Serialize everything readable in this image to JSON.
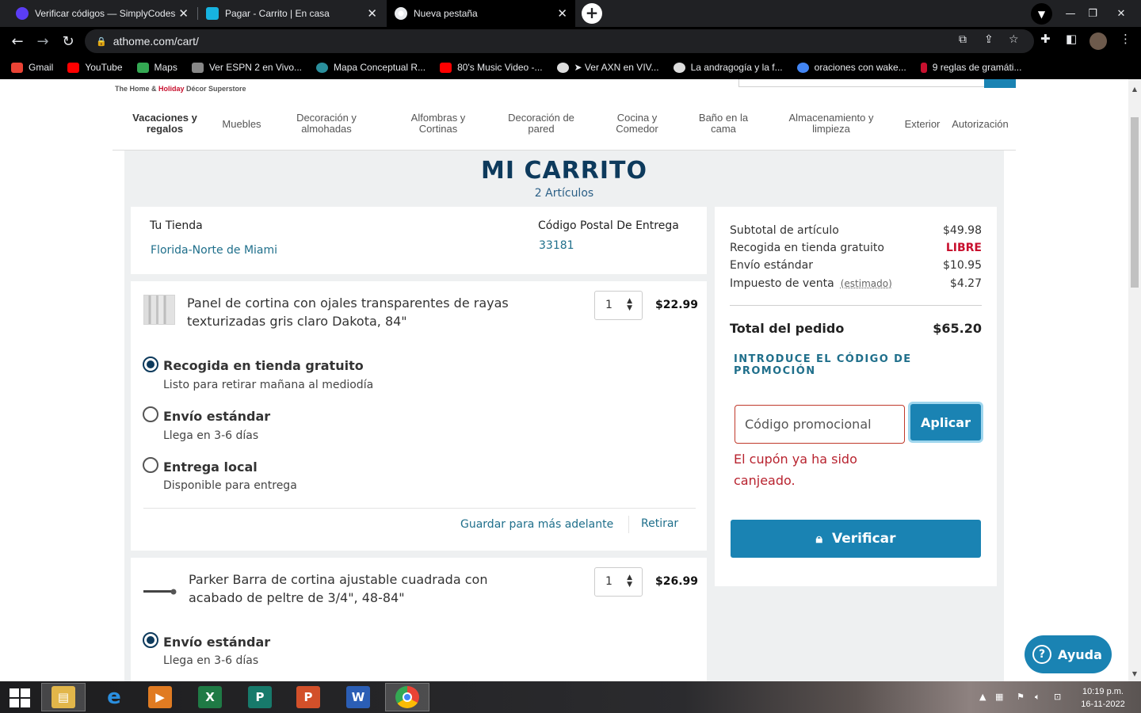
{
  "browser": {
    "tabs": [
      {
        "title": "Verificar códigos — SimplyCodes",
        "icon": "simplycodes-icon"
      },
      {
        "title": "Pagar - Carrito | En casa",
        "icon": "athome-icon"
      },
      {
        "title": "Nueva pestaña",
        "icon": "chrome-icon"
      }
    ],
    "url": "athome.com/cart/",
    "bookmarks": [
      {
        "label": "Gmail",
        "color": "#ea4335"
      },
      {
        "label": "YouTube",
        "color": "#ff0000"
      },
      {
        "label": "Maps",
        "color": "#34a853"
      },
      {
        "label": "Ver ESPN 2 en Vivo...",
        "color": "#888888"
      },
      {
        "label": "Mapa Conceptual R...",
        "color": "#2a8f9c"
      },
      {
        "label": "80's Music Video -...",
        "color": "#ff0000"
      },
      {
        "label": "➤ Ver AXN en VIV...",
        "color": "#dddddd"
      },
      {
        "label": "La andragogía y la f...",
        "color": "#dddddd"
      },
      {
        "label": "oraciones con wake...",
        "color": "#4285f4"
      },
      {
        "label": "9 reglas de gramáti...",
        "color": "#c8102e"
      }
    ]
  },
  "site": {
    "tagline_prefix": "The Home & ",
    "tagline_holiday": "Holiday",
    "tagline_suffix": " Décor Superstore",
    "nav": [
      "Vacaciones y regalos",
      "Muebles",
      "Decoración y almohadas",
      "Alfombras y Cortinas",
      "Decoración de pared",
      "Cocina y Comedor",
      "Baño en la cama",
      "Almacenamiento y limpieza",
      "Exterior",
      "Autorización"
    ]
  },
  "cart": {
    "title": "MI CARRITO",
    "count": "2 Artículos",
    "store_label": "Tu Tienda",
    "store_value": "Florida-Norte de Miami",
    "zip_label": "Código Postal De Entrega",
    "zip_value": "33181",
    "items": [
      {
        "name": "Panel de cortina con ojales transparentes de rayas texturizadas gris claro Dakota, 84\"",
        "qty": "1",
        "price": "$22.99",
        "options": [
          {
            "title": "Recogida en tienda gratuito",
            "sub": "Listo para retirar mañana al mediodía",
            "selected": true
          },
          {
            "title": "Envío estándar",
            "sub": "Llega en 3-6 días",
            "selected": false
          },
          {
            "title": "Entrega local",
            "sub": "Disponible para entrega",
            "selected": false
          }
        ],
        "save_later": "Guardar para más adelante",
        "remove": "Retirar"
      },
      {
        "name": "Parker Barra de cortina ajustable cuadrada con acabado de peltre de 3/4\", 48-84\"",
        "qty": "1",
        "price": "$26.99",
        "options": [
          {
            "title": "Envío estándar",
            "sub": "Llega en 3-6 días",
            "selected": true
          }
        ]
      }
    ]
  },
  "summary": {
    "subtotal_label": "Subtotal de artículo",
    "subtotal_value": "$49.98",
    "pickup_label": "Recogida en tienda gratuito",
    "pickup_value": "LIBRE",
    "shipping_label": "Envío estándar",
    "shipping_value": "$10.95",
    "tax_label": "Impuesto de venta",
    "tax_note": "(estimado)",
    "tax_value": "$4.27",
    "total_label": "Total del pedido",
    "total_value": "$65.20",
    "promo_link": "INTRODUCE EL CÓDIGO DE PROMOCIÓN",
    "promo_placeholder": "Código promocional",
    "apply_label": "Aplicar",
    "promo_error": "El cupón ya ha sido canjeado.",
    "checkout_label": "Verificar"
  },
  "help_label": "Ayuda",
  "taskbar": {
    "time": "10:19 p.m.",
    "date": "16-11-2022",
    "apps": [
      "file-explorer-icon",
      "internet-explorer-icon",
      "media-player-icon",
      "excel-icon",
      "publisher-icon",
      "powerpoint-icon",
      "word-icon",
      "chrome-icon"
    ]
  },
  "colors": {
    "accent": "#1a83b3",
    "title": "#0d3a5c",
    "link": "#1f6f8b",
    "error": "#b8232f",
    "free": "#c8102e"
  }
}
